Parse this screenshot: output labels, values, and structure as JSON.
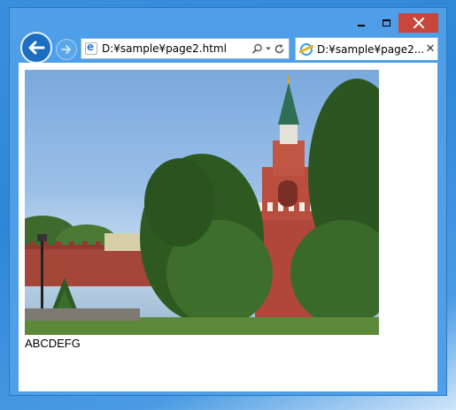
{
  "window": {
    "controls": {
      "minimize_icon": "minimize-icon",
      "maximize_icon": "maximize-icon",
      "close_icon": "close-icon",
      "close_color": "#c9463d"
    }
  },
  "nav": {
    "back_icon": "back-arrow-icon",
    "forward_icon": "forward-arrow-icon"
  },
  "address_bar": {
    "value": "D:¥sample¥page2.html",
    "search_icon": "search-icon",
    "dropdown_icon": "chevron-down-icon",
    "refresh_icon": "refresh-icon"
  },
  "tabs": [
    {
      "label": "D:¥sample¥page2....",
      "icon": "ie-icon",
      "close_icon": "close-icon"
    }
  ],
  "page": {
    "image_description_icon": "photo",
    "caption": "ABCDEFG"
  },
  "colors": {
    "chrome_blue": "#4f9fe8",
    "back_button": "#1c6fc0",
    "close_button": "#c9463d"
  }
}
